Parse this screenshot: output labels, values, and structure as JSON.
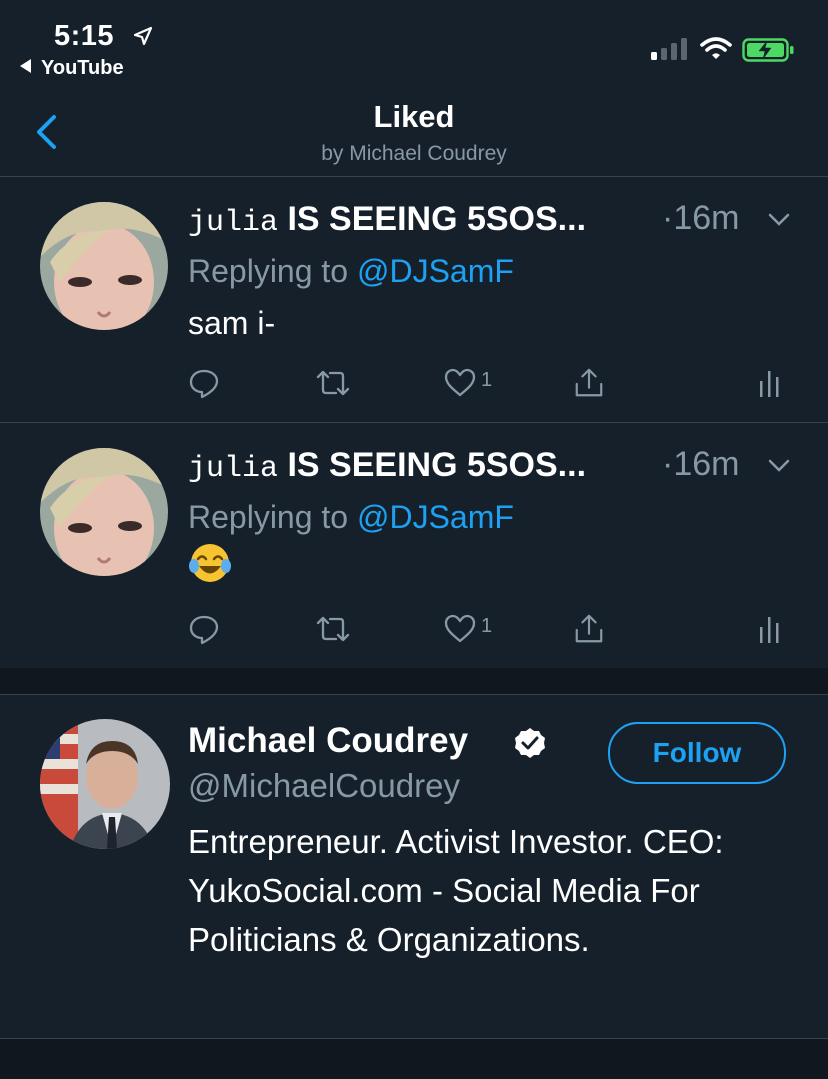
{
  "status_bar": {
    "time": "5:15",
    "back_app": "YouTube",
    "battery_color": "#4cd964"
  },
  "header": {
    "title": "Liked",
    "subtitle": "by Michael Coudrey"
  },
  "tweets": [
    {
      "name_prefix": "julia",
      "name_rest": "IS SEEING 5SOS...",
      "time": "·16m",
      "replying_label": "Replying to",
      "reply_handle": "@DJSamF",
      "text": "sam i-",
      "like_count": "1"
    },
    {
      "name_prefix": "julia",
      "name_rest": "IS SEEING 5SOS...",
      "time": "·16m",
      "replying_label": "Replying to",
      "reply_handle": "@DJSamF",
      "text": "",
      "emoji": "face-with-tears-of-joy-icon",
      "like_count": "1"
    }
  ],
  "profile": {
    "name": "Michael Coudrey",
    "handle": "@MichaelCoudrey",
    "follow_label": "Follow",
    "bio": "Entrepreneur. Activist Investor. CEO: YukoSocial.com - Social Media For Politicians & Organizations."
  },
  "colors": {
    "background": "#15202b",
    "accent": "#1da1f2",
    "secondary_text": "#8899a6",
    "divider": "#38444d"
  }
}
